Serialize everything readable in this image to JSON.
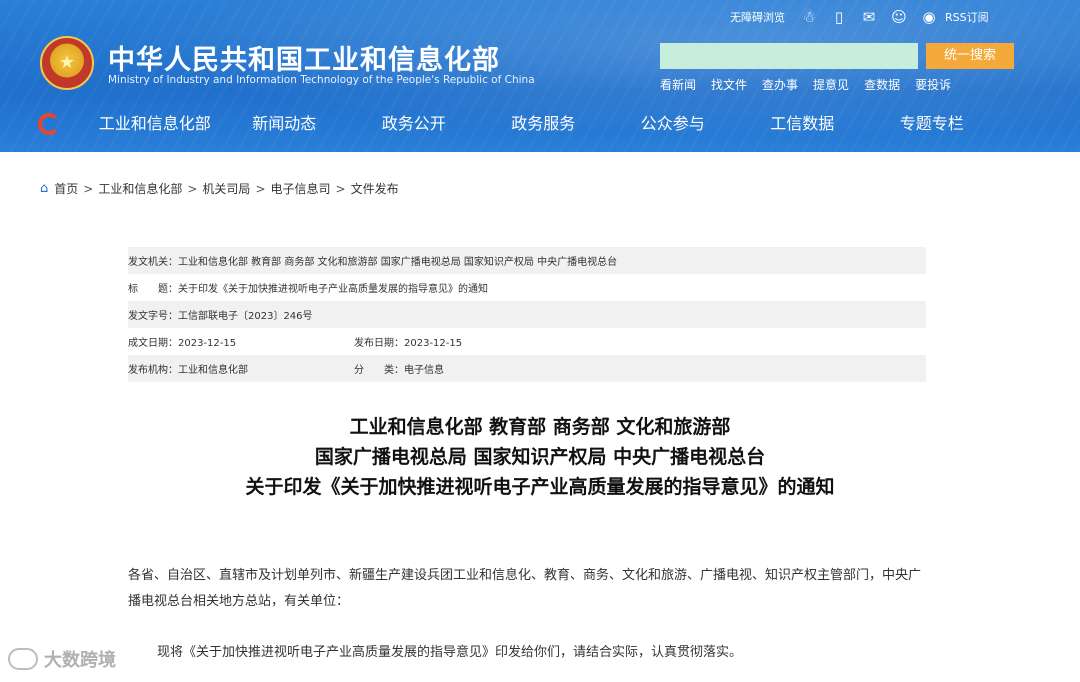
{
  "header": {
    "site_title": "中华人民共和国工业和信息化部",
    "site_subtitle": "Ministry of Industry and Information Technology of the People's Republic of China",
    "top_links": {
      "accessibility": "无障碍浏览",
      "rss": "RSS订阅"
    },
    "search": {
      "placeholder": "",
      "button": "统一搜索"
    },
    "quick_links": [
      "看新闻",
      "找文件",
      "查办事",
      "提意见",
      "查数据",
      "要投诉"
    ]
  },
  "nav": [
    "工业和信息化部",
    "新闻动态",
    "政务公开",
    "政务服务",
    "公众参与",
    "工信数据",
    "专题专栏"
  ],
  "breadcrumb": [
    "首页",
    "工业和信息化部",
    "机关司局",
    "电子信息司",
    "文件发布"
  ],
  "meta": {
    "issuer": "发文机关：工业和信息化部 教育部 商务部 文化和旅游部 国家广播电视总局 国家知识产权局 中央广播电视总台",
    "title": "标　　题：关于印发《关于加快推进视听电子产业高质量发展的指导意见》的通知",
    "doc_no": "发文字号：工信部联电子〔2023〕246号",
    "created": "成文日期：2023-12-15",
    "published": "发布日期：2023-12-15",
    "agency": "发布机构：工业和信息化部",
    "category": "分　　类：电子信息"
  },
  "document": {
    "title_lines": [
      "工业和信息化部 教育部 商务部 文化和旅游部",
      "国家广播电视总局 国家知识产权局 中央广播电视总台",
      "关于印发《关于加快推进视听电子产业高质量发展的指导意见》的通知"
    ],
    "para1": "各省、自治区、直辖市及计划单列市、新疆生产建设兵团工业和信息化、教育、商务、文化和旅游、广播电视、知识产权主管部门，中央广播电视总台相关地方总站，有关单位：",
    "para2": "现将《关于加快推进视听电子产业高质量发展的指导意见》印发给你们，请结合实际，认真贯彻落实。"
  },
  "watermark": "大数跨境"
}
